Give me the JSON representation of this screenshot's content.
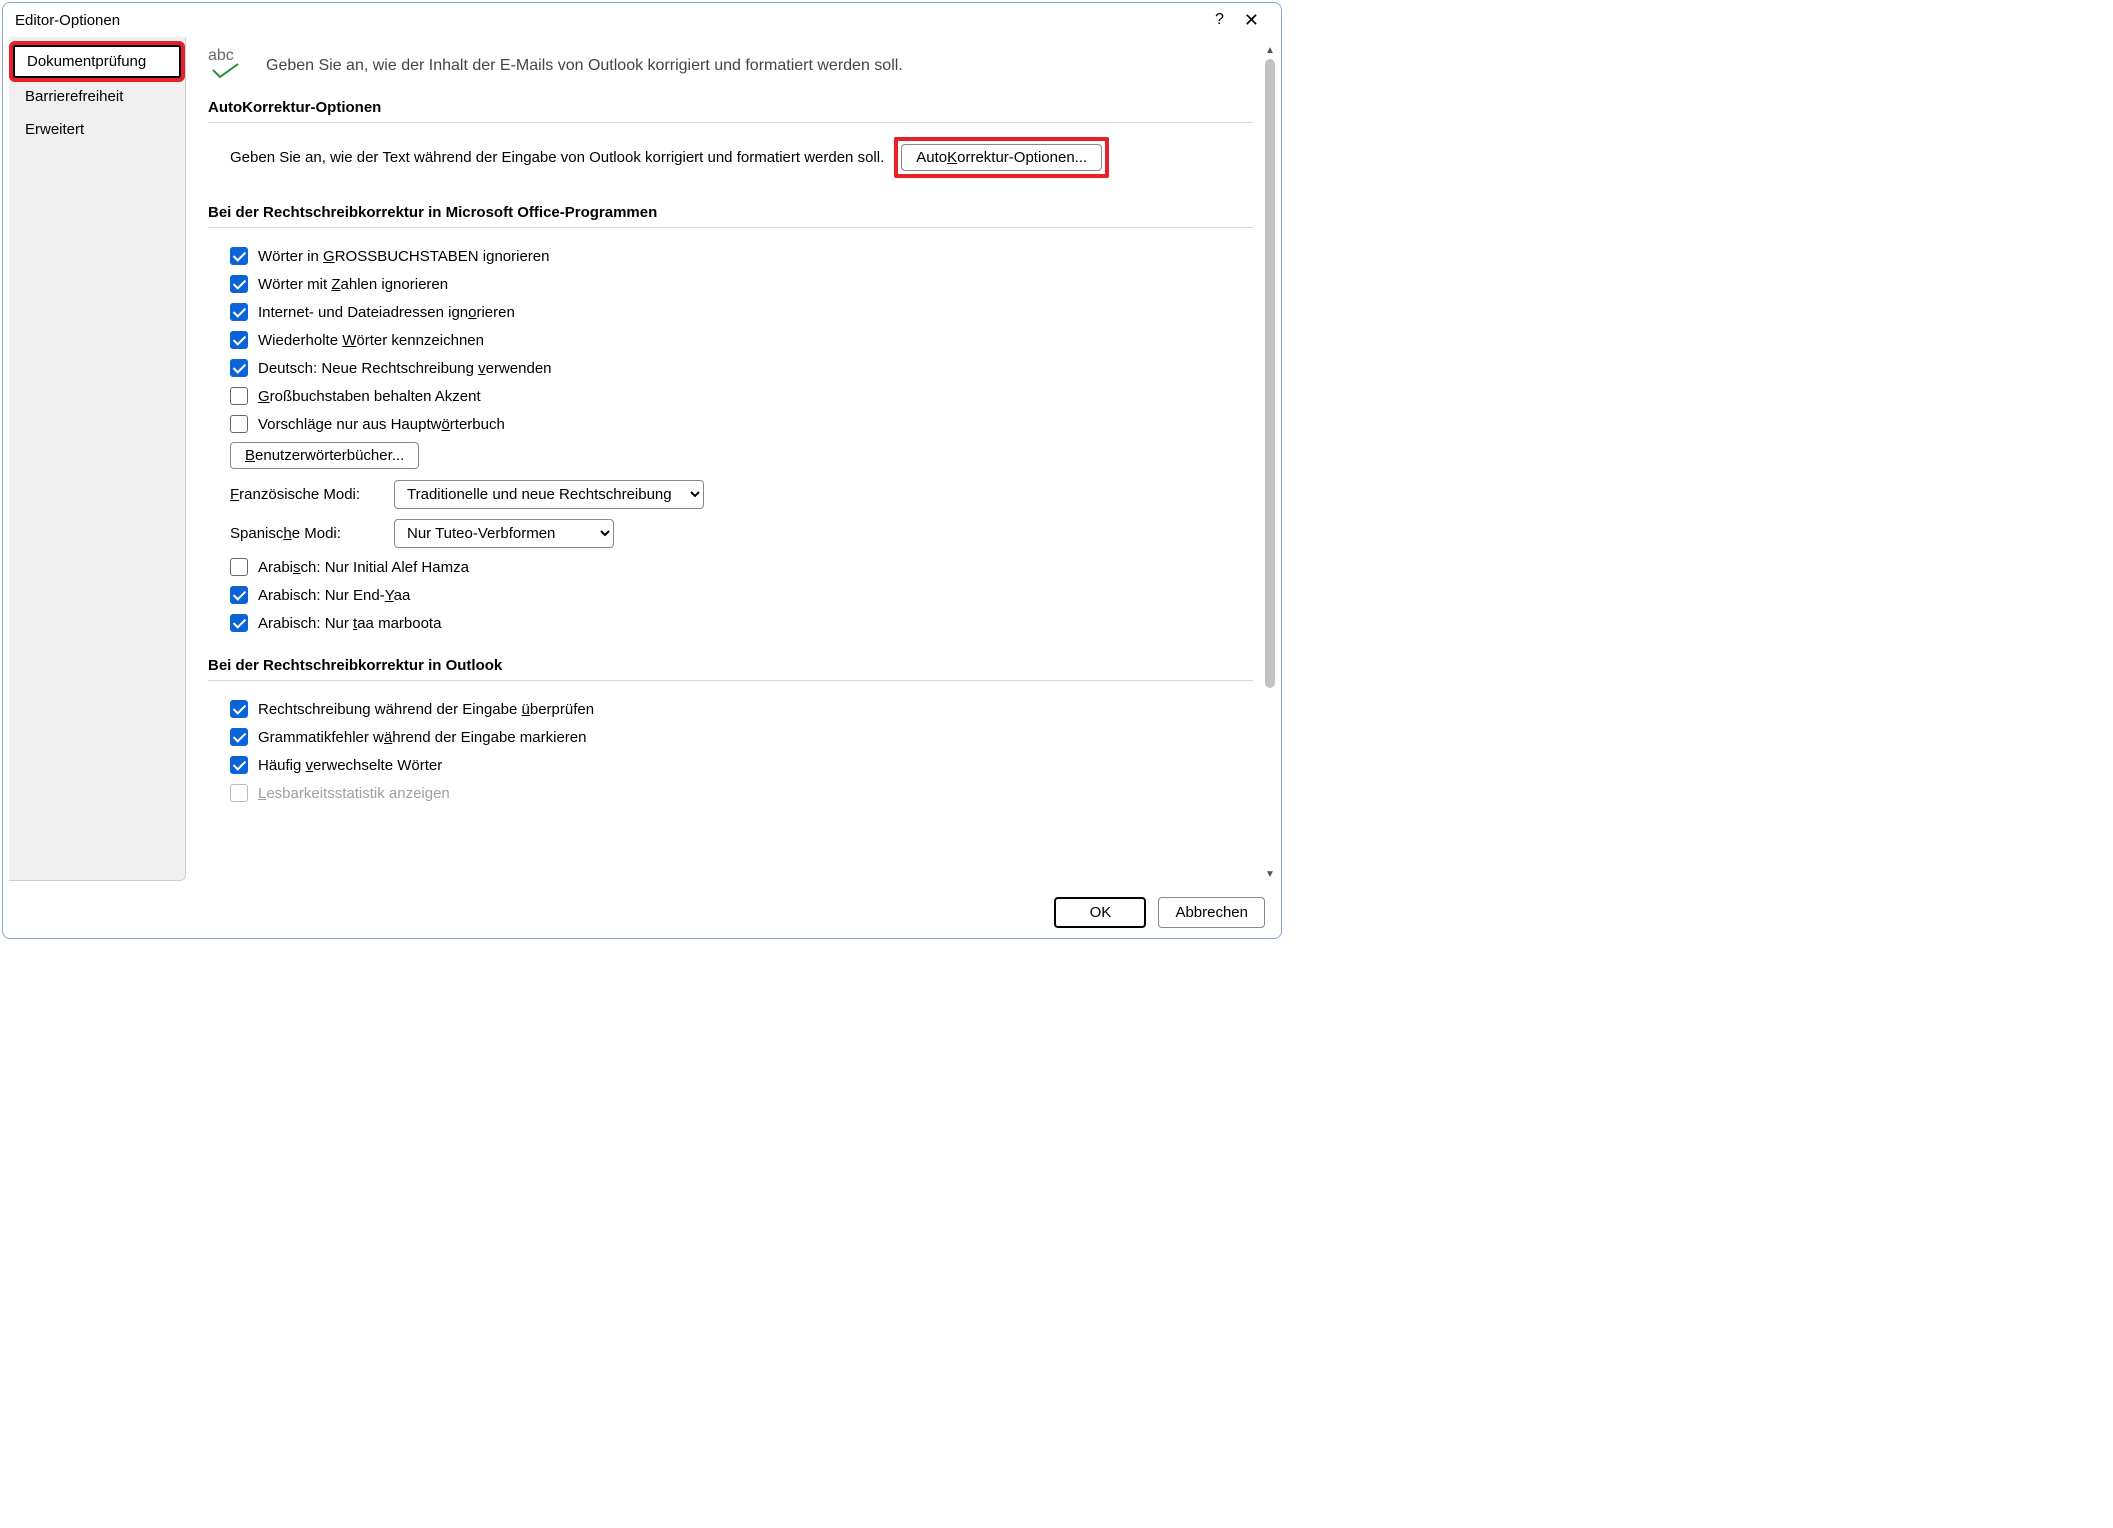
{
  "window": {
    "title": "Editor-Optionen"
  },
  "sidebar": {
    "items": [
      {
        "label": "Dokumentprüfung",
        "selected": true
      },
      {
        "label": "Barrierefreiheit",
        "selected": false
      },
      {
        "label": "Erweitert",
        "selected": false
      }
    ]
  },
  "header": {
    "icon_text": "abc",
    "description": "Geben Sie an, wie der Inhalt der E-Mails von Outlook korrigiert und formatiert werden soll."
  },
  "sections": {
    "autocorrect": {
      "title": "AutoKorrektur-Optionen",
      "description": "Geben Sie an, wie der Text während der Eingabe von Outlook korrigiert und formatiert werden soll.",
      "button_label": "AutoKorrektur-Optionen...",
      "button_accel": "K"
    },
    "office_spell": {
      "title": "Bei der Rechtschreibkorrektur in Microsoft Office-Programmen",
      "checkboxes": [
        {
          "label": "Wörter in GROSSBUCHSTABEN ignorieren",
          "checked": true,
          "accel": "G"
        },
        {
          "label": "Wörter mit Zahlen ignorieren",
          "checked": true,
          "accel": "Z"
        },
        {
          "label": "Internet- und Dateiadressen ignorieren",
          "checked": true,
          "accel": "o"
        },
        {
          "label": "Wiederholte Wörter kennzeichnen",
          "checked": true,
          "accel": "W"
        },
        {
          "label": "Deutsch: Neue Rechtschreibung verwenden",
          "checked": true,
          "accel": "v"
        },
        {
          "label": "Großbuchstaben behalten Akzent",
          "checked": false,
          "accel": "G"
        },
        {
          "label": "Vorschläge nur aus Hauptwörterbuch",
          "checked": false,
          "accel": "ö"
        }
      ],
      "dict_button": "Benutzerwörterbücher...",
      "dict_accel": "B",
      "french_label": "Französische Modi:",
      "french_accel": "F",
      "french_value": "Traditionelle und neue Rechtschreibung",
      "spanish_label": "Spanische Modi:",
      "spanish_accel": "h",
      "spanish_value": "Nur Tuteo-Verbformen",
      "arabic_checks": [
        {
          "label": "Arabisch: Nur Initial Alef Hamza",
          "checked": false,
          "accel": "s"
        },
        {
          "label": "Arabisch: Nur End-Yaa",
          "checked": true,
          "accel": "Y"
        },
        {
          "label": "Arabisch: Nur taa marboota",
          "checked": true,
          "accel": "t"
        }
      ]
    },
    "outlook_spell": {
      "title": "Bei der Rechtschreibkorrektur in Outlook",
      "checkboxes": [
        {
          "label": "Rechtschreibung während der Eingabe überprüfen",
          "checked": true,
          "accel": "ü",
          "disabled": false
        },
        {
          "label": "Grammatikfehler während der Eingabe markieren",
          "checked": true,
          "accel": "ä",
          "disabled": false
        },
        {
          "label": "Häufig verwechselte Wörter",
          "checked": true,
          "accel": "v",
          "disabled": false
        },
        {
          "label": "Lesbarkeitsstatistik anzeigen",
          "checked": false,
          "accel": "L",
          "disabled": true
        }
      ]
    }
  },
  "footer": {
    "ok": "OK",
    "cancel": "Abbrechen"
  }
}
